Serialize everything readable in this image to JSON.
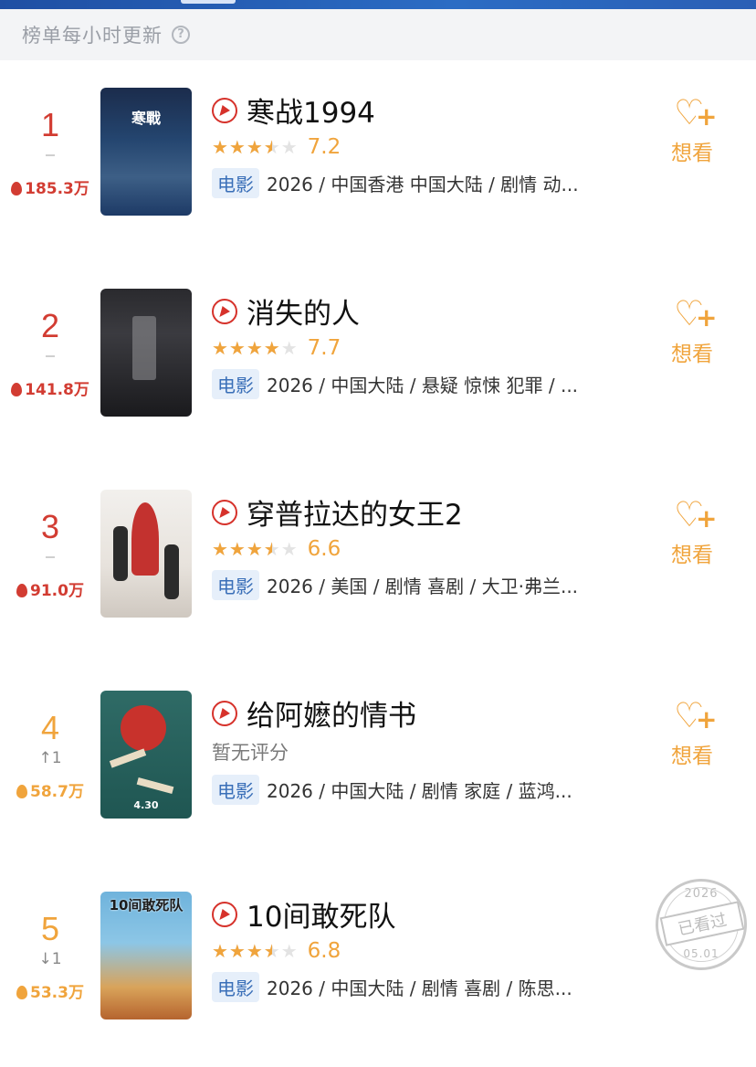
{
  "header": {
    "update_note": "榜单每小时更新",
    "help_symbol": "?"
  },
  "colors": {
    "rank_top": "#d23c32",
    "rank_other": "#f0a43c",
    "accent_orange": "#f0a43c",
    "play_red": "#d6322b",
    "badge_blue": "#3a6fb8"
  },
  "icons": {
    "flame": "flame-icon",
    "play": "play-icon",
    "heart_plus": "heart-plus-icon",
    "help": "help-icon"
  },
  "movies": [
    {
      "rank": "1",
      "change": "",
      "heat": "185.3万",
      "title": "寒战1994",
      "rating_stars": 3.5,
      "score": "7.2",
      "type": "电影",
      "meta": "2026 / 中国香港 中国大陆 / 剧情 动...",
      "want_label": "想看",
      "poster_text": "寒戰"
    },
    {
      "rank": "2",
      "change": "",
      "heat": "141.8万",
      "title": "消失的人",
      "rating_stars": 4,
      "score": "7.7",
      "type": "电影",
      "meta": "2026 / 中国大陆 / 悬疑 惊悚 犯罪 / ...",
      "want_label": "想看",
      "poster_text": ""
    },
    {
      "rank": "3",
      "change": "",
      "heat": "91.0万",
      "title": "穿普拉达的女王2",
      "rating_stars": 3.5,
      "score": "6.6",
      "type": "电影",
      "meta": "2026 / 美国 / 剧情 喜剧 / 大卫·弗兰...",
      "want_label": "想看",
      "poster_text": ""
    },
    {
      "rank": "4",
      "change": "↑1",
      "heat": "58.7万",
      "title": "给阿嬷的情书",
      "no_rating": "暂无评分",
      "type": "电影",
      "meta": "2026 / 中国大陆 / 剧情 家庭 / 蓝鸿...",
      "want_label": "想看",
      "poster_text": "4.30"
    },
    {
      "rank": "5",
      "change": "↓1",
      "heat": "53.3万",
      "title": "10间敢死队",
      "rating_stars": 3.5,
      "score": "6.8",
      "type": "电影",
      "meta": "2026 / 中国大陆 / 剧情 喜剧 / 陈思...",
      "watched_stamp": {
        "year": "2026",
        "label": "已看过",
        "date": "05.01"
      },
      "poster_text": "10间敢死队"
    }
  ]
}
